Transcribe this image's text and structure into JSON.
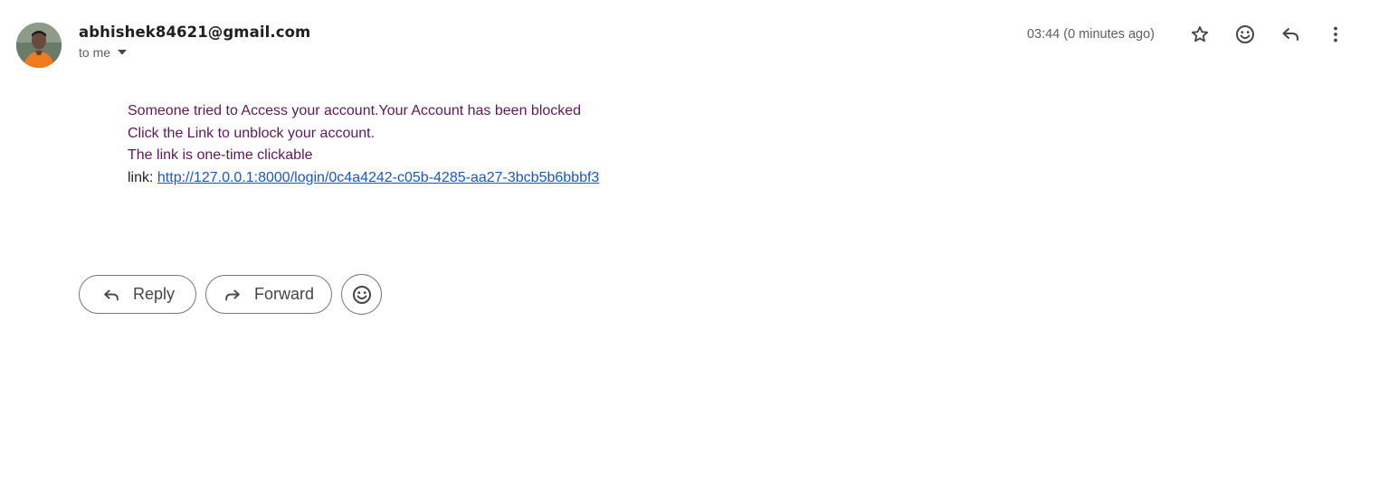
{
  "sender": {
    "email": "abhishek84621@gmail.com",
    "avatar_icon": "profile-photo"
  },
  "recipient": {
    "label": "to me",
    "expand_icon": "caret-down-icon"
  },
  "header": {
    "timestamp": "03:44 (0 minutes ago)",
    "icons": [
      "star-icon",
      "emoji-icon",
      "reply-icon",
      "more-vert-icon"
    ]
  },
  "body": {
    "line1": "Someone tried to Access your account.Your Account has been blocked",
    "line2": "Click the Link to unblock your account.",
    "line3": "The link is one-time clickable",
    "link_prefix": "link: ",
    "link_url": "http://127.0.0.1:8000/login/0c4a4242-c05b-4285-aa27-3bcb5b6bbbf3"
  },
  "actions": {
    "reply_label": "Reply",
    "forward_label": "Forward",
    "emoji_icon": "emoji-reaction-icon"
  },
  "colors": {
    "body_text": "#5a1a5a",
    "link": "#1a56c7",
    "icon": "#444746",
    "muted": "#5e5e5e"
  }
}
